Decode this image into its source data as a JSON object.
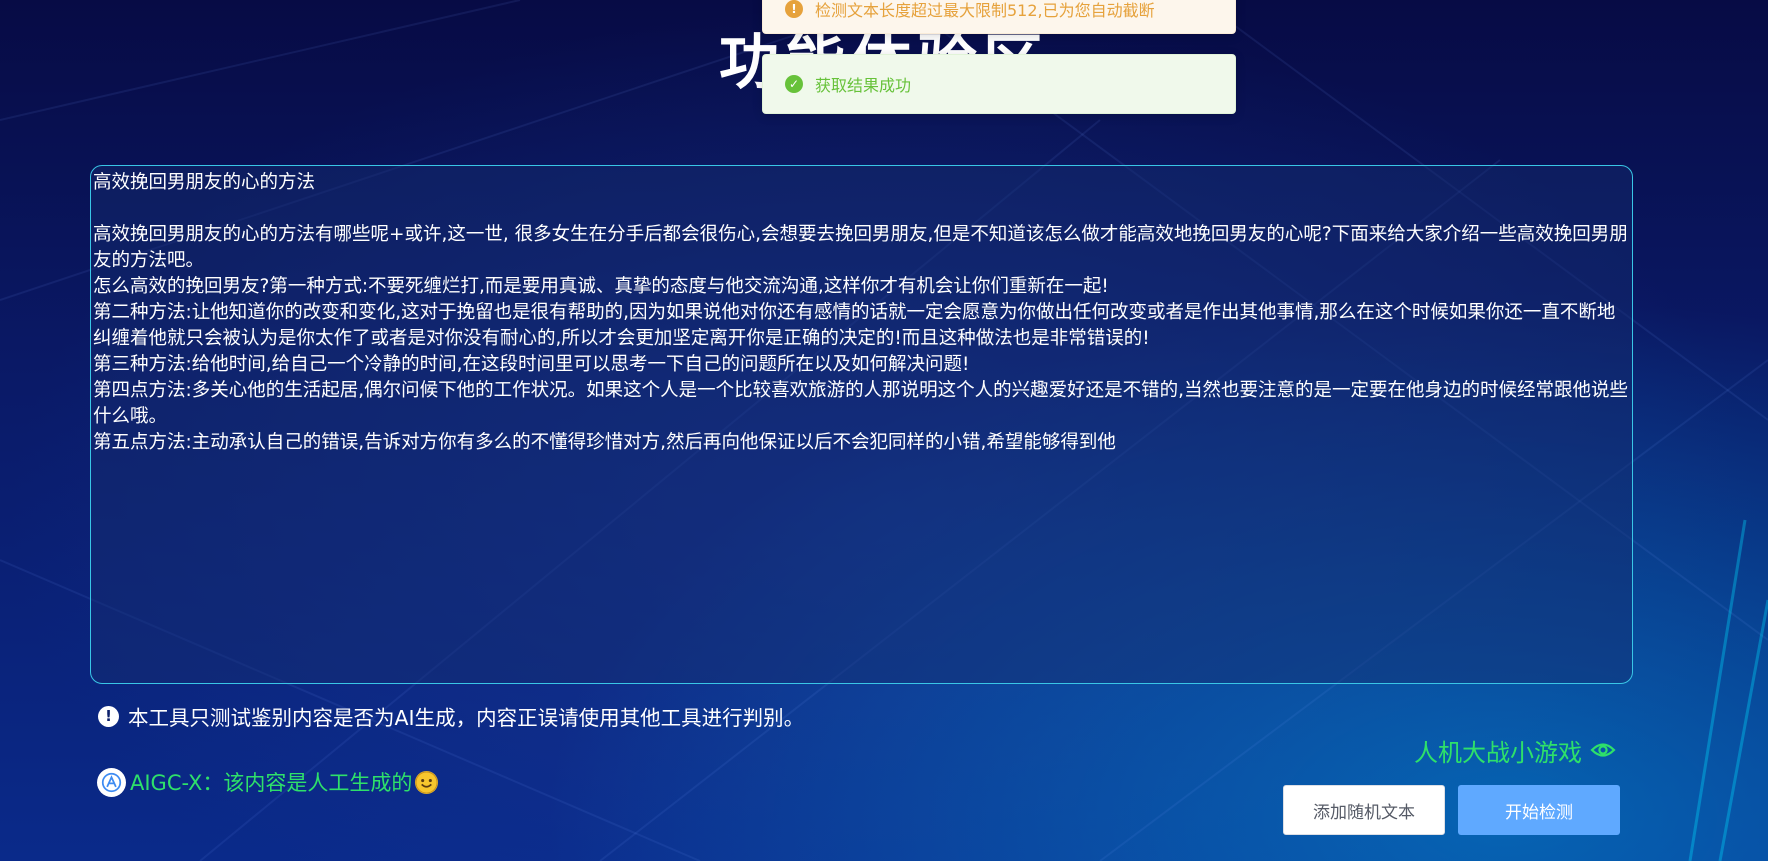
{
  "page": {
    "title": "功能体验区"
  },
  "toasts": {
    "warning": "检测文本长度超过最大限制512,已为您自动截断",
    "success": "获取结果成功"
  },
  "content": {
    "heading": "高效挽回男朋友的心的方法",
    "paragraphs": [
      "高效挽回男朋友的心的方法有哪些呢+或许,这一世, 很多女生在分手后都会很伤心,会想要去挽回男朋友,但是不知道该怎么做才能高效地挽回男友的心呢?下面来给大家介绍一些高效挽回男朋友的方法吧。",
      "怎么高效的挽回男友?第一种方式:不要死缠烂打,而是要用真诚、真挚的态度与他交流沟通,这样你才有机会让你们重新在一起!",
      "第二种方法:让他知道你的改变和变化,这对于挽留也是很有帮助的,因为如果说他对你还有感情的话就一定会愿意为你做出任何改变或者是作出其他事情,那么在这个时候如果你还一直不断地纠缠着他就只会被认为是你太作了或者是对你没有耐心的,所以才会更加坚定离开你是正确的决定的!而且这种做法也是非常错误的!",
      "第三种方法:给他时间,给自己一个冷静的时间,在这段时间里可以思考一下自己的问题所在以及如何解决问题!",
      "第四点方法:多关心他的生活起居,偶尔问候下他的工作状况。如果这个人是一个比较喜欢旅游的人那说明这个人的兴趣爱好还是不错的,当然也要注意的是一定要在他身边的时候经常跟他说些什么哦。",
      "第五点方法:主动承认自己的错误,告诉对方你有多么的不懂得珍惜对方,然后再向他保证以后不会犯同样的小错,希望能够得到他"
    ]
  },
  "disclaimer": "本工具只测试鉴别内容是否为AI生成，内容正误请使用其他工具进行判别。",
  "result": {
    "prefix": "AIGC-X：",
    "text": "该内容是人工生成的"
  },
  "game_link": "人机大战小游戏",
  "buttons": {
    "random": "添加随机文本",
    "start": "开始检测"
  },
  "colors": {
    "panel_border": "#39c6e6",
    "result_green": "#2ee06a",
    "primary_button": "#5fa9ff"
  },
  "icons": {
    "warning": "warning-icon",
    "success": "check-circle-icon",
    "alert": "exclamation-circle-icon",
    "logo": "aigc-logo-icon",
    "emoji": "smile-icon",
    "eye": "eye-icon"
  }
}
